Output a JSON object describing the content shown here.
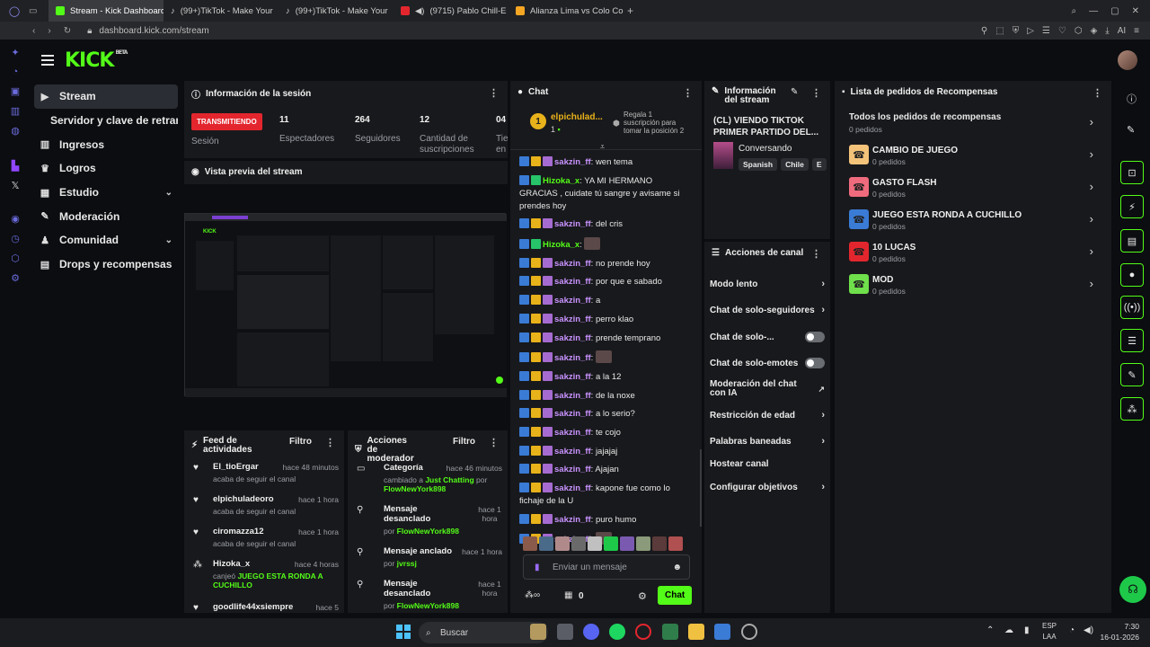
{
  "browser": {
    "tabs": [
      {
        "label": "Stream - Kick Dashboard",
        "active": true,
        "color": "#53fc18"
      },
      {
        "label": "(99+)TikTok - Make Your",
        "active": false,
        "color": "#ffffff"
      },
      {
        "label": "(99+)TikTok - Make Your",
        "active": false,
        "color": "#ffffff"
      },
      {
        "label": "(9715) Pablo Chill-E -",
        "active": false,
        "color": "#e3262e"
      },
      {
        "label": "Alianza Lima vs Colo Colo",
        "active": false,
        "color": "#f5a623"
      }
    ],
    "new_tab": "+",
    "url": "dashboard.kick.com/stream",
    "ai_label": "AI"
  },
  "header": {
    "logo": "KICK",
    "beta": "BETA"
  },
  "nav": {
    "items": [
      {
        "label": "Stream",
        "icon": "play-icon",
        "glyph": "▶",
        "active": true
      },
      {
        "label": "Servidor y clave de retransmisión",
        "icon": "",
        "glyph": "",
        "sub": true
      },
      {
        "label": "Ingresos",
        "icon": "chart-icon",
        "glyph": "▥"
      },
      {
        "label": "Logros",
        "icon": "trophy-icon",
        "glyph": "♛"
      },
      {
        "label": "Estudio",
        "icon": "grid-icon",
        "glyph": "▦",
        "chevron": true
      },
      {
        "label": "Moderación",
        "icon": "wrench-icon",
        "glyph": "✎"
      },
      {
        "label": "Comunidad",
        "icon": "people-icon",
        "glyph": "♟",
        "chevron": true
      },
      {
        "label": "Drops y recompensas",
        "icon": "gift-icon",
        "glyph": "▤"
      }
    ]
  },
  "session": {
    "title": "Información de la sesión",
    "status": "TRANSMITIENDO",
    "status_label": "Sesión",
    "stats": [
      {
        "value": "11",
        "label": "Espectadores"
      },
      {
        "value": "264",
        "label": "Seguidores"
      },
      {
        "value": "12",
        "label": "Cantidad de suscripciones"
      },
      {
        "value": "04",
        "label": "Tie en"
      }
    ]
  },
  "preview": {
    "title": "Vista previa del stream"
  },
  "activity": {
    "title": "Feed de actividades",
    "filter": "Filtro",
    "items": [
      {
        "who": "El_tioErgar",
        "time": "hace 48 minutos",
        "desc": "acaba de seguir el canal",
        "icon": "heart-icon"
      },
      {
        "who": "elpichuladeoro",
        "time": "hace 1 hora",
        "desc": "acaba de seguir el canal",
        "icon": "heart-icon"
      },
      {
        "who": "ciromazza12",
        "time": "hace 1 hora",
        "desc": "acaba de seguir el canal",
        "icon": "heart-icon"
      },
      {
        "who": "Hizoka_x",
        "time": "hace 4 horas",
        "desc": "canjeó",
        "highlight": "JUEGO ESTA RONDA A CUCHILLO",
        "icon": "points-icon"
      },
      {
        "who": "goodlife44xsiempre",
        "time": "hace 5",
        "desc": "",
        "icon": "heart-icon"
      }
    ]
  },
  "modactions": {
    "title": "Acciones de moderador",
    "filter": "Filtro",
    "items": [
      {
        "title": "Categoría",
        "time": "hace 46 minutos",
        "line1": "cambiado a",
        "hl1": "Just Chatting",
        "line2": "por",
        "hl2": "FlowNewYork898",
        "icon": "category-icon"
      },
      {
        "title": "Mensaje desanclado",
        "time": "hace 1 hora",
        "line2": "por",
        "hl2": "FlowNewYork898",
        "icon": "unpin-icon"
      },
      {
        "title": "Mensaje anclado",
        "time": "hace 1 hora",
        "line2": "por",
        "hl2": "jvrssj",
        "icon": "pin-icon"
      },
      {
        "title": "Mensaje desanclado",
        "time": "hace 1 hora",
        "line2": "por",
        "hl2": "FlowNewYork898",
        "icon": "unpin-icon"
      }
    ]
  },
  "chat": {
    "title": "Chat",
    "top_gifter": {
      "rank": "1",
      "name": "elpichulad...",
      "count": "1"
    },
    "gift_cta": "Regala 1 suscripción para tomar la posición 2",
    "messages": [
      {
        "user": "sakzin_ff",
        "text": "wen tema",
        "color": "#c993ff",
        "mod": true
      },
      {
        "user": "Hizoka_x",
        "text": "YA MI HERMANO GRACIAS , cuidate tú sangre y avisame si prendes hoy",
        "color": "#53fc18",
        "mod": false
      },
      {
        "user": "sakzin_ff",
        "text": "del cris",
        "color": "#c993ff",
        "mod": true
      },
      {
        "user": "Hizoka_x",
        "text": "",
        "emote": true,
        "color": "#53fc18",
        "mod": false
      },
      {
        "user": "sakzin_ff",
        "text": "no prende hoy",
        "color": "#c993ff",
        "mod": true
      },
      {
        "user": "sakzin_ff",
        "text": "por que e sabado",
        "color": "#c993ff",
        "mod": true
      },
      {
        "user": "sakzin_ff",
        "text": "a",
        "color": "#c993ff",
        "mod": true
      },
      {
        "user": "sakzin_ff",
        "text": "perro klao",
        "color": "#c993ff",
        "mod": true
      },
      {
        "user": "sakzin_ff",
        "text": "prende temprano",
        "color": "#c993ff",
        "mod": true
      },
      {
        "user": "sakzin_ff",
        "text": "",
        "emote": true,
        "color": "#c993ff",
        "mod": true
      },
      {
        "user": "sakzin_ff",
        "text": "a la 12",
        "color": "#c993ff",
        "mod": true
      },
      {
        "user": "sakzin_ff",
        "text": "de la noxe",
        "color": "#c993ff",
        "mod": true
      },
      {
        "user": "sakzin_ff",
        "text": "a lo serio?",
        "color": "#c993ff",
        "mod": true
      },
      {
        "user": "sakzin_ff",
        "text": "te cojo",
        "color": "#c993ff",
        "mod": true
      },
      {
        "user": "sakzin_ff",
        "text": "jajajaj",
        "color": "#c993ff",
        "mod": true
      },
      {
        "user": "sakzin_ff",
        "text": "Ajajan",
        "color": "#c993ff",
        "mod": true
      },
      {
        "user": "sakzin_ff",
        "text": "kapone fue como lo fichaje de la U",
        "color": "#c993ff",
        "mod": true
      },
      {
        "user": "sakzin_ff",
        "text": "puro humo",
        "color": "#c993ff",
        "mod": true
      },
      {
        "user": "sakzin_ff",
        "text": "",
        "emote": true,
        "color": "#c993ff",
        "mod": true
      }
    ],
    "placeholder": "Enviar un mensaje",
    "points": "0",
    "send": "Chat"
  },
  "streaminfo": {
    "title": "Información del stream",
    "stream_title": "(CL) VIENDO TIKTOK PRIMER PARTIDO DEL...",
    "category": "Conversando",
    "tags": [
      "Spanish",
      "Chile",
      "E"
    ]
  },
  "channel_actions": {
    "title": "Acciones de canal",
    "items": [
      {
        "label": "Modo lento",
        "type": "chevron"
      },
      {
        "label": "Chat de solo-seguidores",
        "type": "chevron"
      },
      {
        "label": "Chat de solo-...",
        "type": "toggle"
      },
      {
        "label": "Chat de solo-emotes",
        "type": "toggle"
      },
      {
        "label": "Moderación del chat con IA",
        "type": "external"
      },
      {
        "label": "Restricción de edad",
        "type": "chevron"
      },
      {
        "label": "Palabras baneadas",
        "type": "chevron"
      },
      {
        "label": "Hostear canal",
        "type": "none"
      },
      {
        "label": "Configurar objetivos",
        "type": "chevron"
      }
    ]
  },
  "rewards": {
    "title": "Lista de pedidos de Recompensas",
    "all_label": "Todos los pedidos de recompensas",
    "all_count": "0 pedidos",
    "items": [
      {
        "name": "CAMBIO DE JUEGO",
        "count": "0 pedidos",
        "color": "#f4c37a"
      },
      {
        "name": "GASTO FLASH",
        "count": "0 pedidos",
        "color": "#ee6b7d"
      },
      {
        "name": "JUEGO ESTA RONDA A CUCHILLO",
        "count": "0 pedidos",
        "color": "#3a7bd5"
      },
      {
        "name": "10 LUCAS",
        "count": "0 pedidos",
        "color": "#e3262e"
      },
      {
        "name": "MOD",
        "count": "0 pedidos",
        "color": "#6fe04b"
      }
    ]
  },
  "taskbar": {
    "search": "Buscar",
    "lang1": "ESP",
    "lang2": "LAA",
    "time": "7:30",
    "date": "16-01-2026"
  },
  "colors": {
    "accent": "#53fc18",
    "live": "#e3262e",
    "panel": "#18191c"
  }
}
